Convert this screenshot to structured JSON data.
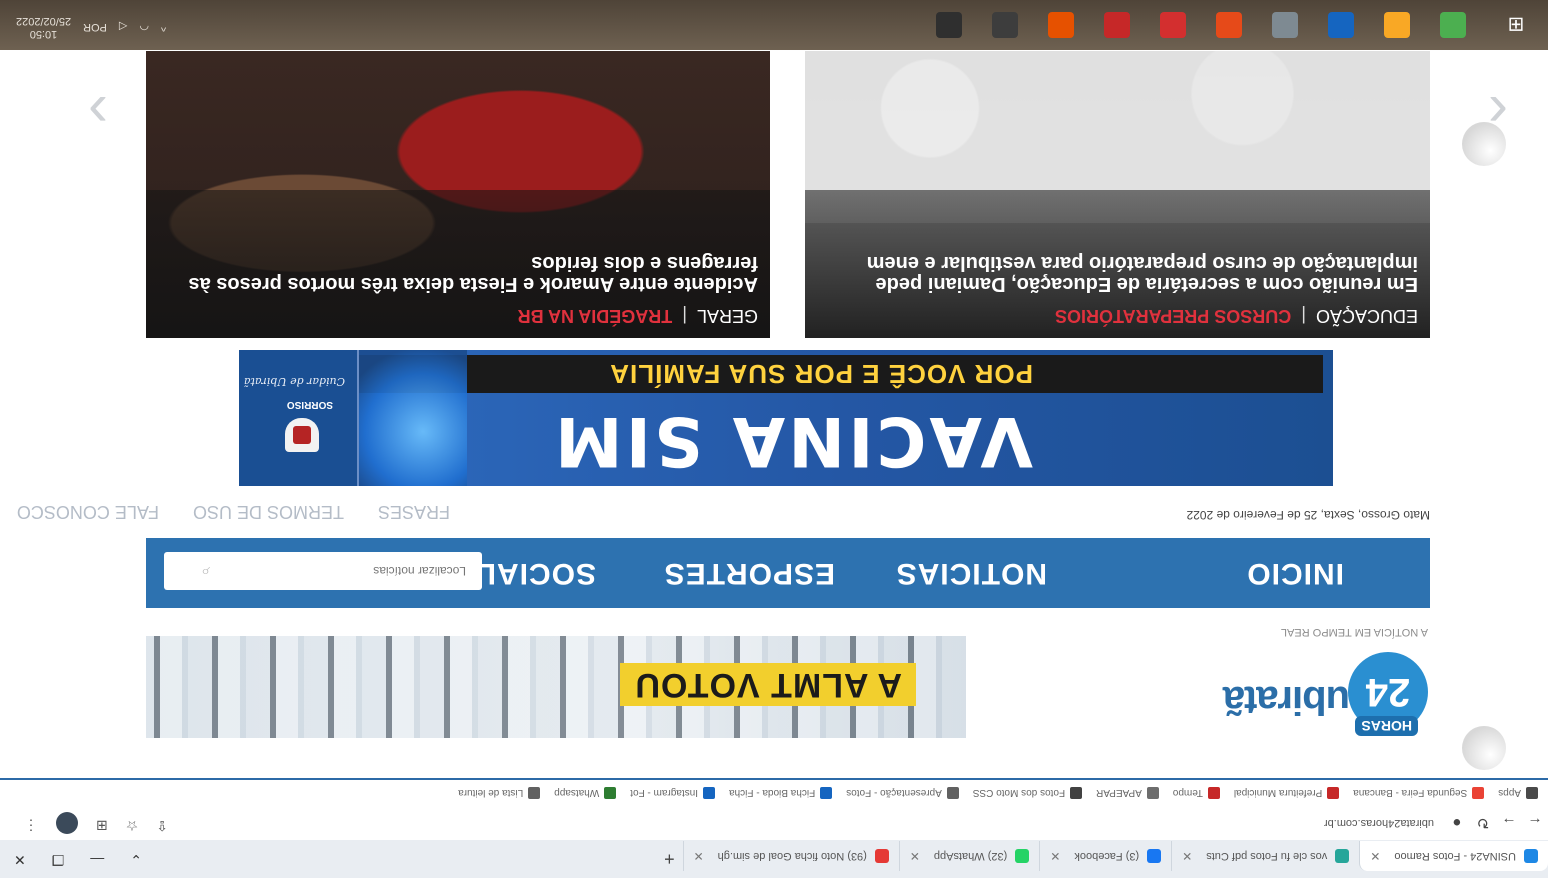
{
  "browser": {
    "tabs": [
      {
        "label": "USINA24 - Fotos Ramoo",
        "icon_color": "#1e88e5"
      },
      {
        "label": "vos cle fu Fotos pdf Cuts",
        "icon_color": "#26a69a"
      },
      {
        "label": "(3) Facebook",
        "icon_color": "#1877f2"
      },
      {
        "label": "(32) WhatsApp",
        "icon_color": "#25d366"
      },
      {
        "label": "(93) Noto ficha Goal de sim.gh",
        "icon_color": "#e53935"
      }
    ],
    "url": "ubirata24horas.com.br",
    "bookmarks": [
      {
        "label": "Apps",
        "icon_color": "#4a4a4a"
      },
      {
        "label": "Segunda Feira - Bancana",
        "icon_color": "#ea4335"
      },
      {
        "label": "Prefeitura Municipal",
        "icon_color": "#c62828"
      },
      {
        "label": "Tempo",
        "icon_color": "#c62828"
      },
      {
        "label": "APAEPAR",
        "icon_color": "#6d6d6d"
      },
      {
        "label": "Fotos dos Moto CSS",
        "icon_color": "#424242"
      },
      {
        "label": "Apresentação - Fotos",
        "icon_color": "#616161"
      },
      {
        "label": "Ficha Bioda - Ficha",
        "icon_color": "#1565c0"
      },
      {
        "label": "Instagram - Fot",
        "icon_color": "#1565c0"
      },
      {
        "label": "Whatsapp",
        "icon_color": "#2e7d32"
      },
      {
        "label": "Lista de leitura",
        "icon_color": "#616161"
      }
    ]
  },
  "site": {
    "logo_text": "ubiratã",
    "logo_badge": "24",
    "logo_badge_small": "HORAS",
    "tagline": "A NOTÍCIA EM TEMPO REAL",
    "hero_ad_label": "A ALMT VOTOU",
    "nav": {
      "items": [
        "INICIO",
        "NOTICIAS",
        "ESPORTES",
        "SOCIAL"
      ],
      "search_placeholder": "Localizar notícias"
    },
    "dateline": "Mato Grosso, Sexta, 25 de Fevereiro de 2022",
    "quick_links": [
      "FRASES",
      "TERMOS DE USO",
      "FALE CONOSCO"
    ],
    "banner": {
      "headline": "VACINA SIM",
      "subline": "POR VOCÊ E POR SUA FAMÍLIA",
      "org_name": "SORRISO",
      "signature": "Cuidar de Ubiratã"
    },
    "cards": [
      {
        "category": "EDUCAÇÃO",
        "subcategory": "CURSOS PREPARATÓRIOS",
        "title": "Em reunião com a secretária de Educação, Damiani pede implantação de curso preparatório para vestibular e enem"
      },
      {
        "category": "GERAL",
        "subcategory": "TRAGÉDIA NA BR",
        "title": "Acidente entre Amarok e Fiesta deixa três mortos presos às ferragens e dois feridos"
      }
    ]
  },
  "taskbar": {
    "clock_time": "10:50",
    "clock_date": "25/02/2022",
    "tray_labels": [
      "POR"
    ],
    "app_colors": [
      "#2f2f2f",
      "#3d3d3d",
      "#e65100",
      "#c62828",
      "#d32f2f",
      "#e64a19",
      "#7e8a92",
      "#1565c0",
      "#f9a825",
      "#4caf50"
    ]
  }
}
